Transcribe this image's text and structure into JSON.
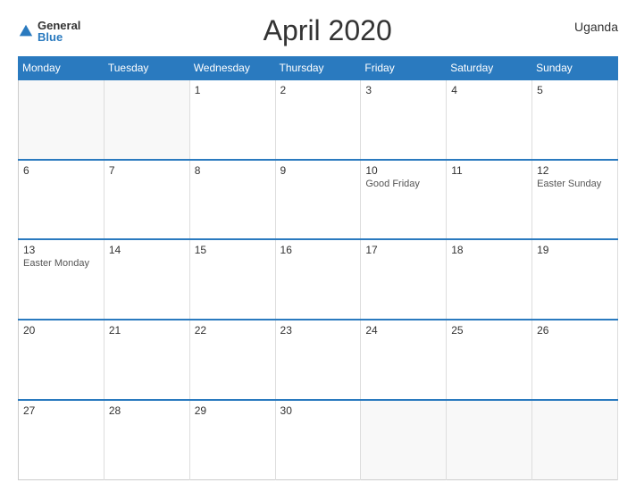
{
  "header": {
    "logo": {
      "line1": "General",
      "line2": "Blue"
    },
    "title": "April 2020",
    "country": "Uganda"
  },
  "days_of_week": [
    "Monday",
    "Tuesday",
    "Wednesday",
    "Thursday",
    "Friday",
    "Saturday",
    "Sunday"
  ],
  "weeks": [
    [
      {
        "num": "",
        "holiday": "",
        "empty": true
      },
      {
        "num": "",
        "holiday": "",
        "empty": true
      },
      {
        "num": "1",
        "holiday": ""
      },
      {
        "num": "2",
        "holiday": ""
      },
      {
        "num": "3",
        "holiday": ""
      },
      {
        "num": "4",
        "holiday": ""
      },
      {
        "num": "5",
        "holiday": ""
      }
    ],
    [
      {
        "num": "6",
        "holiday": ""
      },
      {
        "num": "7",
        "holiday": ""
      },
      {
        "num": "8",
        "holiday": ""
      },
      {
        "num": "9",
        "holiday": ""
      },
      {
        "num": "10",
        "holiday": "Good Friday"
      },
      {
        "num": "11",
        "holiday": ""
      },
      {
        "num": "12",
        "holiday": "Easter Sunday"
      }
    ],
    [
      {
        "num": "13",
        "holiday": "Easter Monday"
      },
      {
        "num": "14",
        "holiday": ""
      },
      {
        "num": "15",
        "holiday": ""
      },
      {
        "num": "16",
        "holiday": ""
      },
      {
        "num": "17",
        "holiday": ""
      },
      {
        "num": "18",
        "holiday": ""
      },
      {
        "num": "19",
        "holiday": ""
      }
    ],
    [
      {
        "num": "20",
        "holiday": ""
      },
      {
        "num": "21",
        "holiday": ""
      },
      {
        "num": "22",
        "holiday": ""
      },
      {
        "num": "23",
        "holiday": ""
      },
      {
        "num": "24",
        "holiday": ""
      },
      {
        "num": "25",
        "holiday": ""
      },
      {
        "num": "26",
        "holiday": ""
      }
    ],
    [
      {
        "num": "27",
        "holiday": ""
      },
      {
        "num": "28",
        "holiday": ""
      },
      {
        "num": "29",
        "holiday": ""
      },
      {
        "num": "30",
        "holiday": ""
      },
      {
        "num": "",
        "holiday": "",
        "empty": true
      },
      {
        "num": "",
        "holiday": "",
        "empty": true
      },
      {
        "num": "",
        "holiday": "",
        "empty": true
      }
    ]
  ]
}
